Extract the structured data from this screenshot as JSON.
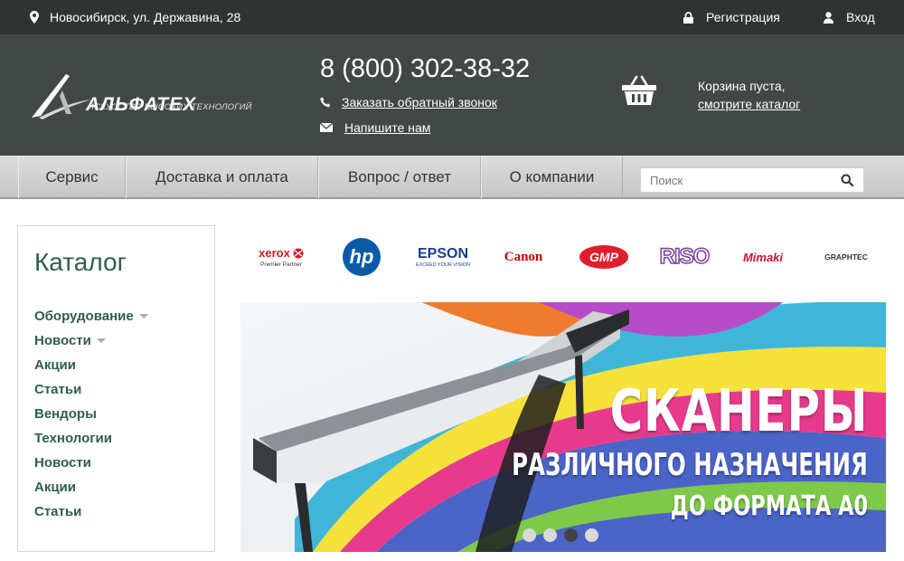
{
  "topbar": {
    "address": "Новосибирск, ул. Державина, 28",
    "register": "Регистрация",
    "login": "Вход"
  },
  "header": {
    "logo_name": "АЛЬФАТЕХ",
    "logo_tagline": "ИСКУССТВО ВЫСОКИХ ТЕХНОЛОГИЙ",
    "phone": "8 (800) 302-38-32",
    "callback": "Заказать обратный звонок",
    "write_us": "Напишите нам",
    "cart_empty": "Корзина пуста,",
    "cart_link": "смотрите каталог"
  },
  "nav": {
    "items": [
      {
        "label": "Сервис"
      },
      {
        "label": "Доставка и оплата"
      },
      {
        "label": "Вопрос / ответ"
      },
      {
        "label": "О компании"
      }
    ],
    "search_placeholder": "Поиск"
  },
  "catalog": {
    "title": "Каталог",
    "items": [
      {
        "label": "Оборудование",
        "expandable": true
      },
      {
        "label": "Новости",
        "expandable": true
      },
      {
        "label": "Акции",
        "expandable": false
      },
      {
        "label": "Статьи",
        "expandable": false
      },
      {
        "label": "Вендоры",
        "expandable": false
      },
      {
        "label": "Технологии",
        "expandable": false
      },
      {
        "label": "Новости",
        "expandable": false
      },
      {
        "label": "Акции",
        "expandable": false
      },
      {
        "label": "Статьи",
        "expandable": false
      }
    ]
  },
  "brands": {
    "xerox": "xerox",
    "xerox_sub": "Premier Partner",
    "hp": "hp",
    "epson": "EPSON",
    "epson_sub": "EXCEED YOUR VISION",
    "canon": "Canon",
    "gmp": "GMP",
    "riso": "RISO",
    "mimaki": "Mimaki",
    "graphtec": "GRAPHTEC"
  },
  "banner": {
    "line1": "СКАНЕРЫ",
    "line2": "РАЗЛИЧНОГО НАЗНАЧЕНИЯ",
    "line3": "ДО ФОРМАТА А0",
    "slides": 4,
    "active_slide": 3
  },
  "colors": {
    "topbar": "#2f3332",
    "header": "#424846",
    "accent_green": "#2f5d52"
  }
}
